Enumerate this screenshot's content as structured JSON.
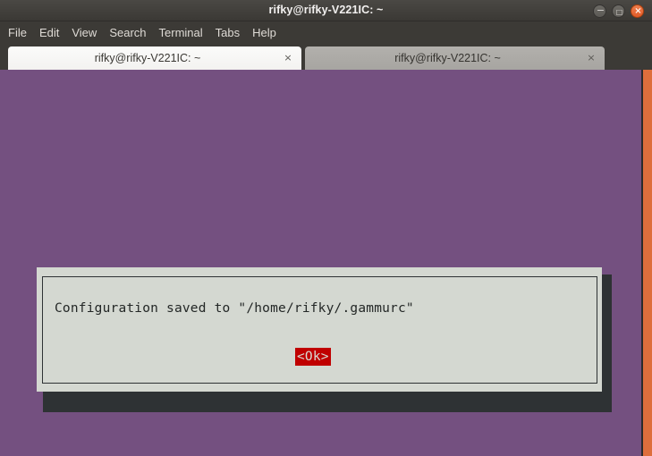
{
  "window": {
    "title": "rifky@rifky-V221IC: ~",
    "controls": {
      "minimize": "−",
      "maximize": "□",
      "close": "×"
    }
  },
  "menubar": {
    "items": [
      {
        "label": "File"
      },
      {
        "label": "Edit"
      },
      {
        "label": "View"
      },
      {
        "label": "Search"
      },
      {
        "label": "Terminal"
      },
      {
        "label": "Tabs"
      },
      {
        "label": "Help"
      }
    ]
  },
  "tabbar": {
    "tabs": [
      {
        "label": "rifky@rifky-V221IC: ~",
        "close": "×",
        "active": true
      },
      {
        "label": "rifky@rifky-V221IC: ~",
        "close": "×",
        "active": false
      }
    ],
    "new_tab_icon": "new-tab-icon",
    "tab_menu_icon": "chevron-down-icon"
  },
  "terminal": {
    "background_color": "#745080",
    "scrollbar_color": "#de6e3c"
  },
  "dialog": {
    "message": "Configuration saved to \"/home/rifky/.gammurc\"",
    "ok_label": "<Ok>",
    "ok_background_color": "#c00000",
    "panel_color": "#d4d8d1"
  }
}
